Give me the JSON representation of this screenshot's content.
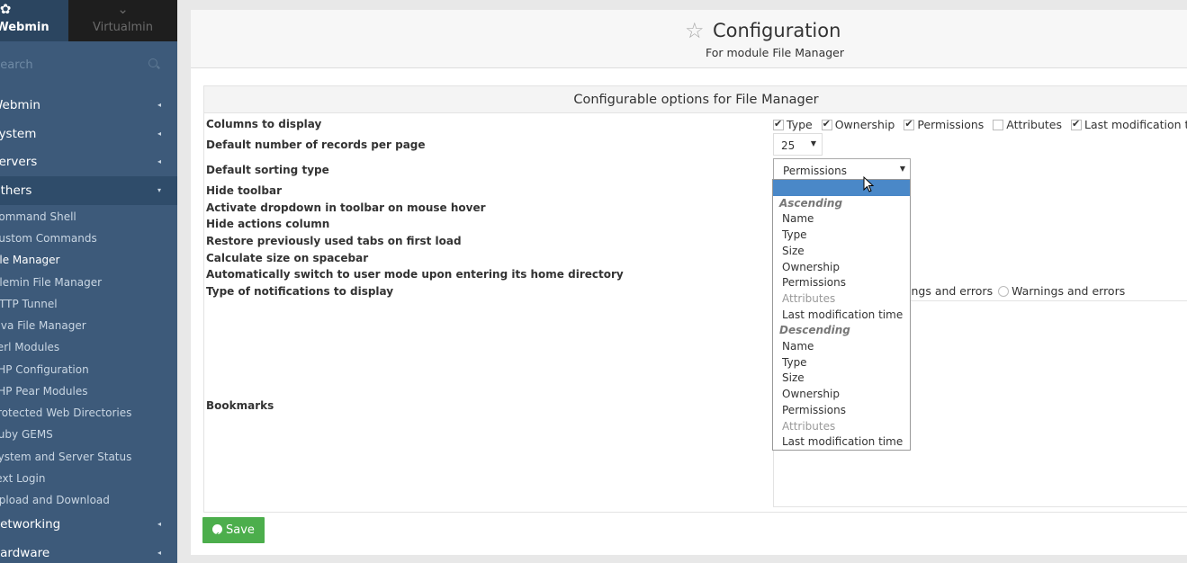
{
  "sidebar": {
    "tabs": {
      "webmin_label": "Webmin",
      "virtualmin_label": "Virtualmin"
    },
    "search_placeholder": "Search",
    "categories": [
      {
        "label": "Webmin"
      },
      {
        "label": "System"
      },
      {
        "label": "Servers"
      },
      {
        "label": "Others"
      },
      {
        "label": "Networking"
      },
      {
        "label": "Hardware"
      }
    ],
    "others_items": [
      "Command Shell",
      "Custom Commands",
      "File Manager",
      "Filemin File Manager",
      "HTTP Tunnel",
      "Java File Manager",
      "Perl Modules",
      "PHP Configuration",
      "PHP Pear Modules",
      "Protected Web Directories",
      "Ruby GEMS",
      "System and Server Status",
      "Text Login",
      "Upload and Download"
    ],
    "current_item": "File Manager"
  },
  "header": {
    "title": "Configuration",
    "subtitle": "For module File Manager"
  },
  "panel": {
    "title": "Configurable options for File Manager",
    "labels": {
      "columns": "Columns to display",
      "records": "Default number of records per page",
      "sorting": "Default sorting type",
      "hide_toolbar": "Hide toolbar",
      "activate_dropdown": "Activate dropdown in toolbar on mouse hover",
      "hide_actions": "Hide actions column",
      "restore_tabs": "Restore previously used tabs on first load",
      "calc_size": "Calculate size on spacebar",
      "auto_switch": "Automatically switch to user mode upon entering its home directory",
      "notifications": "Type of notifications to display",
      "bookmarks": "Bookmarks"
    },
    "columns": [
      {
        "label": "Type",
        "checked": true
      },
      {
        "label": "Ownership",
        "checked": true
      },
      {
        "label": "Permissions",
        "checked": true
      },
      {
        "label": "Attributes",
        "checked": false
      },
      {
        "label": "Last modification time",
        "checked": true
      }
    ],
    "records_per_page": "25",
    "sorting_selected": "Permissions",
    "notifications_partial": "ings and errors",
    "notifications_option": "Warnings and errors"
  },
  "dropdown": {
    "ascending_label": "Ascending",
    "descending_label": "Descending",
    "ascending": [
      "Name",
      "Type",
      "Size",
      "Ownership",
      "Permissions",
      "Attributes",
      "Last modification time"
    ],
    "descending": [
      "Name",
      "Type",
      "Size",
      "Ownership",
      "Permissions",
      "Attributes",
      "Last modification time"
    ]
  },
  "save_label": "Save",
  "colors": {
    "sidebar": "#3d5a7a",
    "save": "#4cae4c",
    "highlight": "#4a88c8"
  }
}
